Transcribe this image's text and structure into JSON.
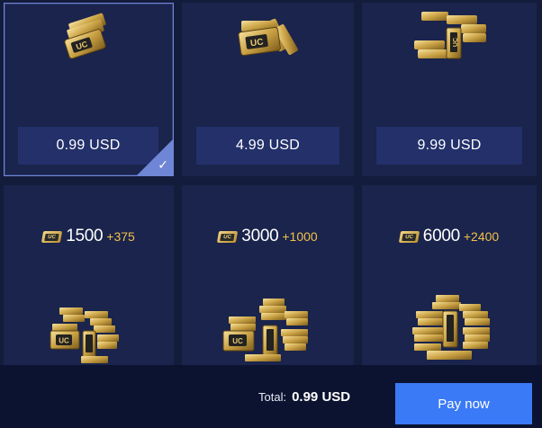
{
  "packages": [
    {
      "price": "0.99 USD",
      "selected": true,
      "icon": "uc-coin-small-pile-icon"
    },
    {
      "price": "4.99 USD",
      "selected": false,
      "icon": "uc-coin-medium-pile-icon"
    },
    {
      "price": "9.99 USD",
      "selected": false,
      "icon": "uc-coin-large-pile-icon"
    },
    {
      "amount": "1500",
      "bonus": "+375",
      "icon": "uc-coin-stack-icon"
    },
    {
      "amount": "3000",
      "bonus": "+1000",
      "icon": "uc-coin-stack-icon"
    },
    {
      "amount": "6000",
      "bonus": "+2400",
      "icon": "uc-coin-stack-icon"
    }
  ],
  "badge_text": "UC",
  "selected_check": "✓",
  "footer": {
    "total_label": "Total:",
    "total_value": "0.99 USD",
    "pay_label": "Pay now"
  },
  "colors": {
    "background": "#141c3c",
    "card": "#1a244c",
    "price_box": "#23306a",
    "selected_border": "#6f86d6",
    "bonus": "#f2c04a",
    "pay_button": "#3b7af6"
  }
}
